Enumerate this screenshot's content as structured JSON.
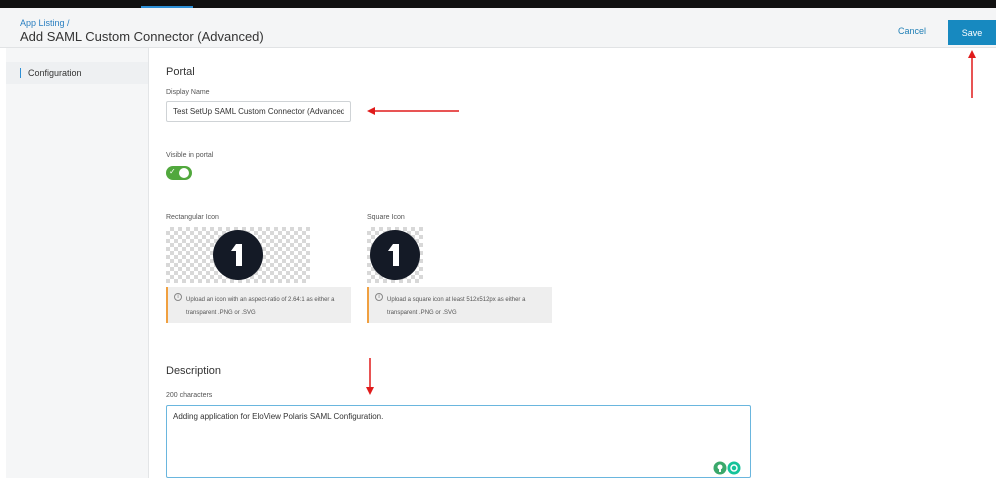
{
  "header": {
    "breadcrumb": "App Listing /",
    "title": "Add SAML Custom Connector (Advanced)",
    "cancel_label": "Cancel",
    "save_label": "Save"
  },
  "sidebar": {
    "items": [
      {
        "label": "Configuration",
        "active": true
      }
    ]
  },
  "portal": {
    "section_title": "Portal",
    "display_name_label": "Display Name",
    "display_name_value": "Test SetUp SAML Custom Connector (Advanced)",
    "visible_label": "Visible in portal",
    "visible_on": true,
    "rect_icon_label": "Rectangular Icon",
    "square_icon_label": "Square Icon",
    "rect_icon_glyph": "1",
    "square_icon_glyph": "1",
    "rect_icon_hint": "Upload an icon with an aspect-ratio of 2.64:1 as either a transparent .PNG or .SVG",
    "square_icon_hint": "Upload a square icon at least 512x512px as either a transparent .PNG or .SVG"
  },
  "description": {
    "section_title": "Description",
    "char_limit_label": "200 characters",
    "value": "Adding application for EloView Polaris SAML Configuration."
  },
  "colors": {
    "accent": "#1789c0",
    "toggle_on": "#51a83d",
    "annotation": "#e01b1b",
    "hint_border": "#f0a040"
  }
}
